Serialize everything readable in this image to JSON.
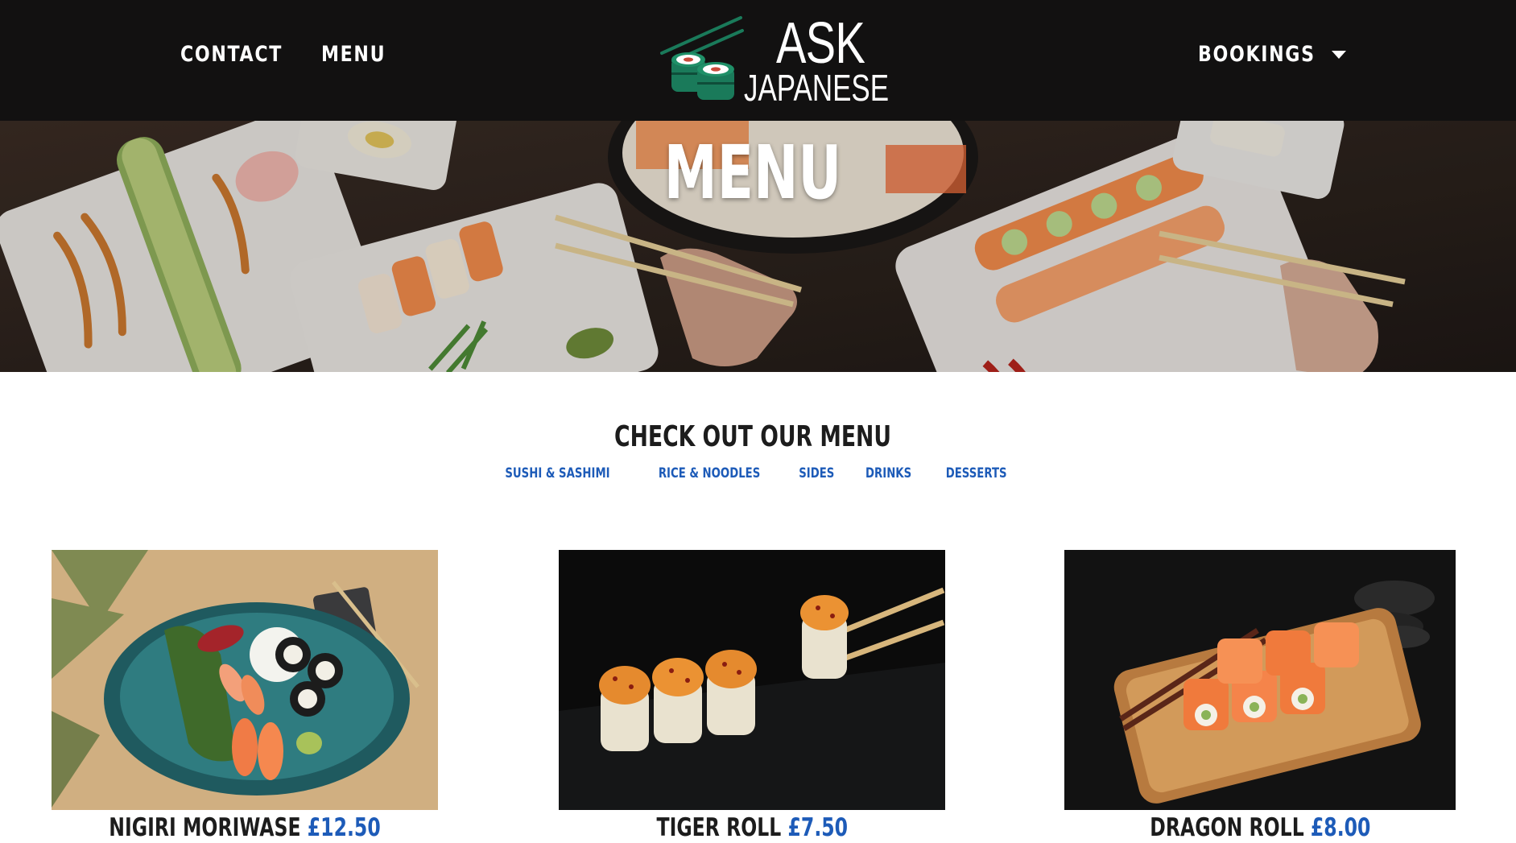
{
  "header": {
    "nav_left": [
      "CONTACT",
      "MENU"
    ],
    "logo_line1": "ASK",
    "logo_line2": "JAPANESE",
    "bookings_label": "BOOKINGS"
  },
  "hero": {
    "title": "MENU"
  },
  "menu": {
    "heading": "CHECK OUT OUR MENU",
    "categories": [
      "SUSHI & SASHIMI",
      "RICE & NOODLES",
      "SIDES",
      "DRINKS",
      "DESSERTS"
    ],
    "items": [
      {
        "name": "NIGIRI MORIWASE",
        "price": "£12.50"
      },
      {
        "name": "TIGER ROLL",
        "price": "£7.50"
      },
      {
        "name": "DRAGON ROLL",
        "price": "£8.00"
      }
    ]
  },
  "colors": {
    "header_bg": "#121111",
    "accent_blue": "#1d5bb8",
    "logo_green": "#1a7a5a"
  }
}
